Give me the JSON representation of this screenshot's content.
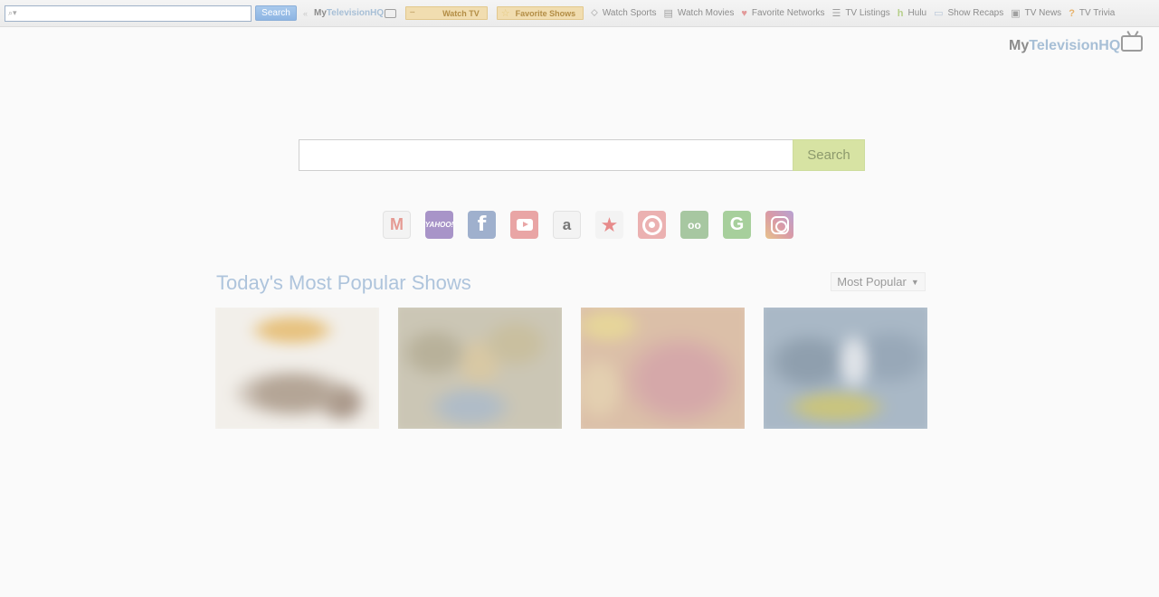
{
  "toolbar": {
    "search_value": "",
    "search_button": "Search",
    "logo": {
      "my": "My",
      "tv": "Television",
      "hq": "HQ"
    },
    "watch_tv": "Watch TV",
    "favorite_shows": "Favorite Shows",
    "links": [
      {
        "label": "Watch Sports",
        "icon": "tag-icon"
      },
      {
        "label": "Watch Movies",
        "icon": "film-icon"
      },
      {
        "label": "Favorite Networks",
        "icon": "heart-icon"
      },
      {
        "label": "TV Listings",
        "icon": "list-icon"
      },
      {
        "label": "Hulu",
        "icon": "hulu-icon"
      },
      {
        "label": "Show Recaps",
        "icon": "chat-bubble-icon"
      },
      {
        "label": "TV News",
        "icon": "newspaper-icon"
      },
      {
        "label": "TV Trivia",
        "icon": "question-mark-icon"
      }
    ]
  },
  "brand": {
    "my": "My",
    "tv": "Television",
    "hq": "HQ"
  },
  "main_search": {
    "value": "",
    "button": "Search"
  },
  "quick_links": [
    {
      "name": "gmail",
      "glyph": "M"
    },
    {
      "name": "yahoo",
      "glyph": "YAHOO!"
    },
    {
      "name": "facebook",
      "glyph": "f"
    },
    {
      "name": "youtube",
      "glyph": ""
    },
    {
      "name": "amazon",
      "glyph": "a"
    },
    {
      "name": "favorites",
      "glyph": "★"
    },
    {
      "name": "target",
      "glyph": ""
    },
    {
      "name": "tripadvisor",
      "glyph": "oo"
    },
    {
      "name": "grammarly",
      "glyph": "G"
    },
    {
      "name": "instagram",
      "glyph": ""
    }
  ],
  "popular": {
    "title": "Today's Most Popular Shows",
    "sort_label": "Most Popular",
    "shows": [
      {
        "id": "show-1"
      },
      {
        "id": "show-2"
      },
      {
        "id": "show-3"
      },
      {
        "id": "show-4"
      }
    ]
  },
  "colors": {
    "accent_blue": "#aec4dc",
    "search_green": "#d7e3a3",
    "pill_tan": "#f1ddb0"
  }
}
